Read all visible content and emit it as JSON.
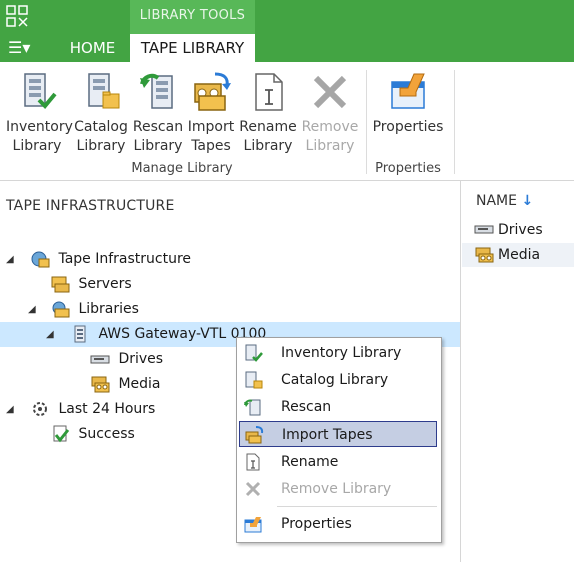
{
  "ribbon_tabs": {
    "context_group": "LIBRARY TOOLS",
    "home": "HOME",
    "tape_library": "TAPE LIBRARY"
  },
  "ribbon": {
    "buttons": [
      {
        "line1": "Inventory",
        "line2": "Library"
      },
      {
        "line1": "Catalog",
        "line2": "Library"
      },
      {
        "line1": "Rescan",
        "line2": "Library"
      },
      {
        "line1": "Import",
        "line2": "Tapes"
      },
      {
        "line1": "Rename",
        "line2": "Library"
      },
      {
        "line1": "Remove",
        "line2": "Library"
      },
      {
        "line1": "Properties",
        "line2": ""
      }
    ],
    "groups": {
      "manage": "Manage Library",
      "properties": "Properties"
    }
  },
  "left_pane": {
    "title": "TAPE INFRASTRUCTURE",
    "tree": [
      {
        "label": "Tape Infrastructure"
      },
      {
        "label": "Servers"
      },
      {
        "label": "Libraries"
      },
      {
        "label": "AWS Gateway-VTL 0100"
      },
      {
        "label": "Drives"
      },
      {
        "label": "Media"
      },
      {
        "label": "Last 24 Hours"
      },
      {
        "label": "Success"
      }
    ]
  },
  "right_pane": {
    "column": "NAME",
    "rows": [
      {
        "label": "Drives"
      },
      {
        "label": "Media"
      }
    ]
  },
  "context_menu": {
    "items": [
      {
        "label": "Inventory Library"
      },
      {
        "label": "Catalog Library"
      },
      {
        "label": "Rescan"
      },
      {
        "label": "Import Tapes"
      },
      {
        "label": "Rename"
      },
      {
        "label": "Remove Library"
      },
      {
        "label": "Properties"
      }
    ]
  },
  "colors": {
    "ribbon_green": "#43a443",
    "selection": "#cce8ff",
    "menu_highlight": "#c5cee3"
  },
  "icons": [
    "app-logo-icon",
    "menu-icon",
    "inventory-library-icon",
    "catalog-library-icon",
    "rescan-library-icon",
    "import-tapes-icon",
    "rename-library-icon",
    "remove-library-icon",
    "properties-icon",
    "tape-infrastructure-icon",
    "servers-icon",
    "libraries-icon",
    "tape-library-icon",
    "drives-icon",
    "media-icon",
    "last-24-hours-icon",
    "success-icon",
    "sort-descending-icon"
  ]
}
